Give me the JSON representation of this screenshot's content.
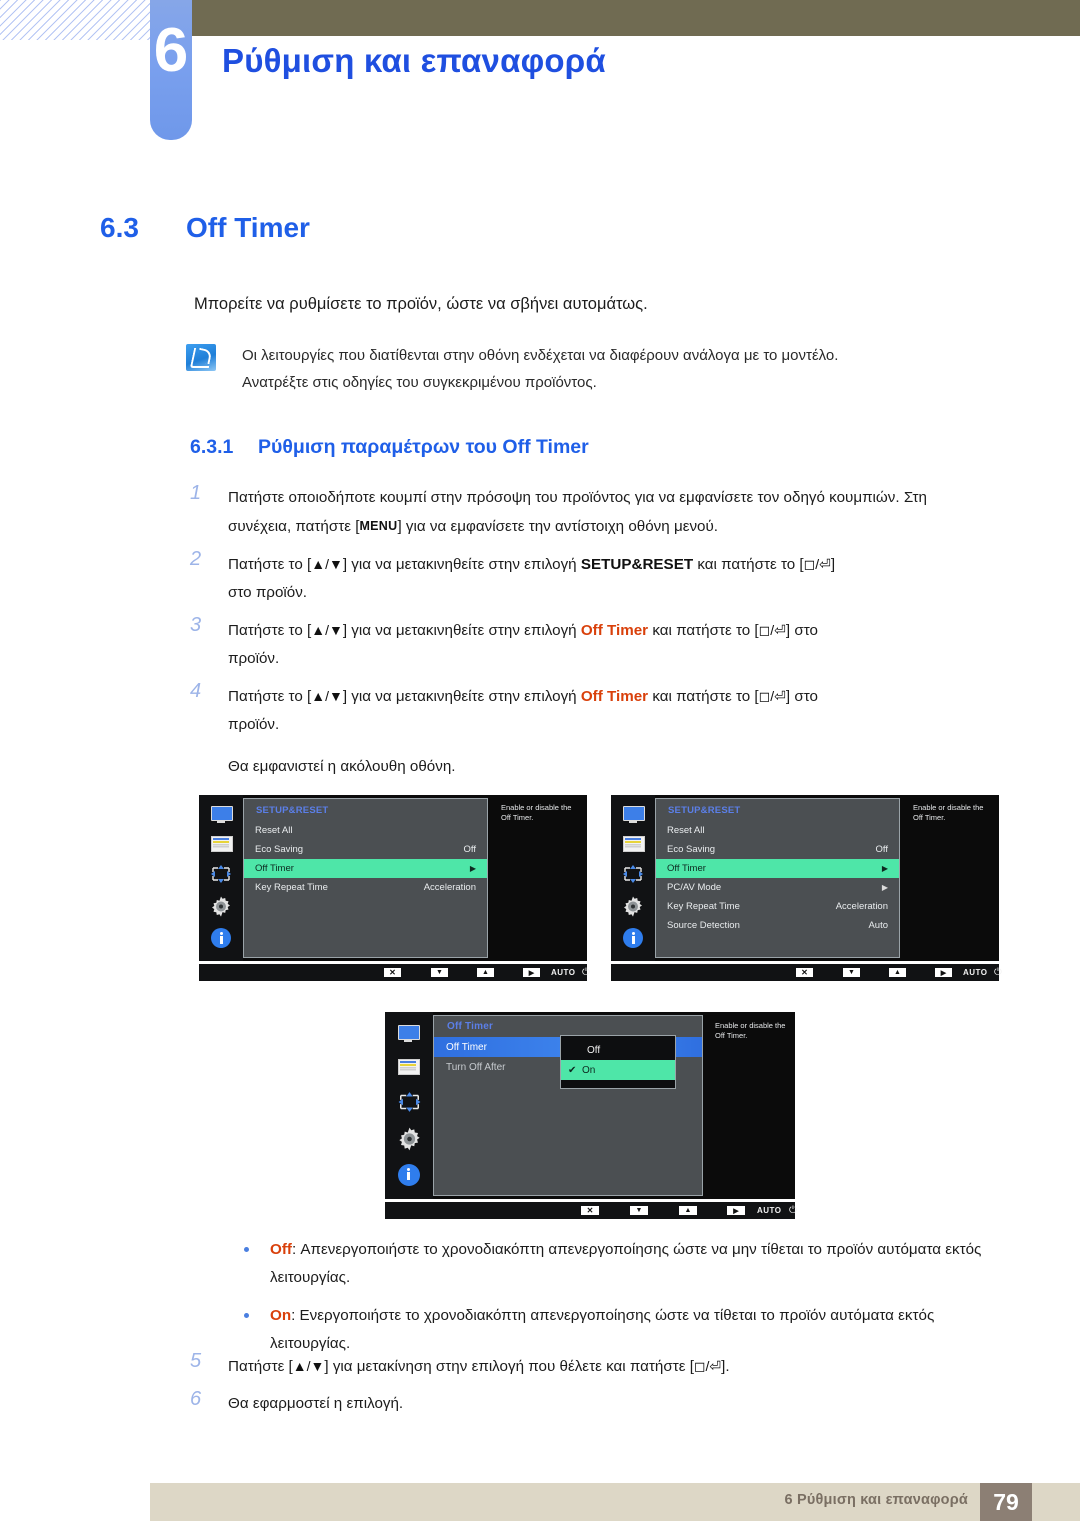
{
  "header": {
    "chapter_number": "6",
    "chapter_title": "Ρύθμιση και επαναφορά"
  },
  "section": {
    "number": "6.3",
    "title": "Off Timer",
    "intro": "Μπορείτε να ρυθμίσετε το προϊόν, ώστε να σβήνει αυτομάτως.",
    "note_line1": "Οι λειτουργίες που διατίθενται στην οθόνη ενδέχεται να διαφέρουν ανάλογα με το μοντέλο.",
    "note_line2": "Ανατρέξτε στις οδηγίες του συγκεκριμένου προϊόντος."
  },
  "subsection": {
    "number": "6.3.1",
    "title": "Ρύθμιση παραμέτρων του Off Timer"
  },
  "steps": {
    "s1_idx": "1",
    "s1_a": "Πατήστε οποιοδήποτε κουμπί στην πρόσοψη του προϊόντος για να εμφανίσετε τον οδηγό κουμπιών. Στη συνέχεια, πατήστε [",
    "s1_key": "MENU",
    "s1_b": "] για να εμφανίσετε την αντίστοιχη οθόνη μενού.",
    "s2_idx": "2",
    "s2_a": "Πατήστε το [",
    "s2_arrows": "▲/▼",
    "s2_b": "] για να μετακινηθείτε στην επιλογή ",
    "s2_target": "SETUP&RESET",
    "s2_c": " και πατήστε το [",
    "s2_keys": "◻/⏎",
    "s2_d": "]",
    "s2_tail": "στο προϊόν.",
    "s3_idx": "3",
    "s3_a": "Πατήστε το [",
    "s3_arrows": "▲/▼",
    "s3_b": "] για να μετακινηθείτε στην επιλογή ",
    "s3_target": "Off Timer",
    "s3_c": " και πατήστε το [",
    "s3_keys": "◻/⏎",
    "s3_d": "] στο",
    "s3_tail": "προϊόν.",
    "s4_idx": "4",
    "s4_a": "Πατήστε το [",
    "s4_arrows": "▲/▼",
    "s4_b": "] για να μετακινηθείτε στην επιλογή ",
    "s4_target": "Off Timer",
    "s4_c": " και πατήστε το [",
    "s4_keys": "◻/⏎",
    "s4_d": "] στο",
    "s4_tail": "προϊόν.",
    "s4_note": "Θα εμφανιστεί η ακόλουθη οθόνη.",
    "s5_idx": "5",
    "s5_a": "Πατήστε [",
    "s5_arrows": "▲/▼",
    "s5_b": "] για μετακίνηση στην επιλογή που θέλετε και πατήστε [",
    "s5_keys": "◻/⏎",
    "s5_c": "].",
    "s6_idx": "6",
    "s6_a": "Θα εφαρμοστεί η επιλογή."
  },
  "osd1": {
    "title": "SETUP&RESET",
    "rows": [
      {
        "label": "Reset All",
        "value": "",
        "selected": false,
        "arrow": false
      },
      {
        "label": "Eco Saving",
        "value": "Off",
        "selected": false,
        "arrow": false
      },
      {
        "label": "Off Timer",
        "value": "",
        "selected": true,
        "arrow": true
      },
      {
        "label": "Key Repeat Time",
        "value": "Acceleration",
        "selected": false,
        "arrow": false
      }
    ],
    "help_line1": "Enable or disable the",
    "help_line2": "Off Timer.",
    "bar": {
      "close": "✕",
      "down": "▼",
      "up": "▲",
      "right": "▶",
      "auto": "AUTO",
      "power": "⏻"
    }
  },
  "osd2": {
    "title": "SETUP&RESET",
    "rows": [
      {
        "label": "Reset All",
        "value": "",
        "selected": false,
        "arrow": false
      },
      {
        "label": "Eco Saving",
        "value": "Off",
        "selected": false,
        "arrow": false
      },
      {
        "label": "Off Timer",
        "value": "",
        "selected": true,
        "arrow": true
      },
      {
        "label": "PC/AV Mode",
        "value": "",
        "selected": false,
        "arrow": true
      },
      {
        "label": "Key Repeat Time",
        "value": "Acceleration",
        "selected": false,
        "arrow": false
      },
      {
        "label": "Source Detection",
        "value": "Auto",
        "selected": false,
        "arrow": false
      }
    ],
    "help_line1": "Enable or disable the",
    "help_line2": "Off Timer.",
    "bar": {
      "close": "✕",
      "down": "▼",
      "up": "▲",
      "right": "▶",
      "auto": "AUTO",
      "power": "⏻"
    }
  },
  "osd3": {
    "title": "Off Timer",
    "rows": [
      {
        "label": "Off Timer",
        "value": "",
        "selected_blue": true
      },
      {
        "label": "Turn Off After",
        "value": "",
        "selected_blue": false
      }
    ],
    "dropdown": [
      {
        "label": "Off",
        "checked": false,
        "selected": false
      },
      {
        "label": "On",
        "checked": true,
        "selected": true
      }
    ],
    "check_glyph": "✔",
    "help_line1": "Enable or disable the",
    "help_line2": "Off Timer.",
    "bar": {
      "close": "✕",
      "down": "▼",
      "up": "▲",
      "right": "▶",
      "auto": "AUTO",
      "power": "⏻"
    }
  },
  "bullets": {
    "b1_label": "Off",
    "b1_text": ": Απενεργοποιήστε το χρονοδιακόπτη απενεργοποίησης ώστε να μην τίθεται το προϊόν αυτόματα εκτός λειτουργίας.",
    "b2_label": "On",
    "b2_text": ": Ενεργοποιήστε το χρονοδιακόπτη απενεργοποίησης ώστε να τίθεται το προϊόν αυτόματα εκτός λειτουργίας."
  },
  "footer": {
    "text": "6 Ρύθμιση και επαναφορά",
    "page": "79"
  },
  "colors": {
    "accent_blue": "#1f5fe8",
    "tab_blue": "#7aa0ee",
    "olive": "#706b52",
    "red": "#d9400b",
    "osd_green": "#4ee6a8",
    "osd_panel": "#4b4f52",
    "footer_bar": "#ddd7c6",
    "footer_page": "#8c7f74"
  }
}
